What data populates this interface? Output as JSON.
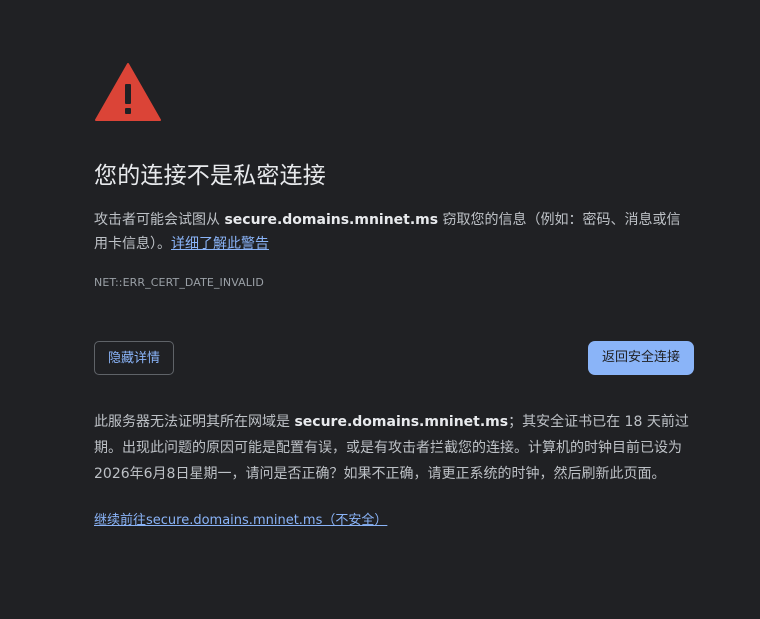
{
  "icon": {
    "name": "warning-triangle-icon",
    "color": "#db4437"
  },
  "heading": "您的连接不是私密连接",
  "description": {
    "before": "攻击者可能会试图从 ",
    "domain": "secure.domains.mninet.ms",
    "after": " 窃取您的信息（例如：密码、消息或信用卡信息）。",
    "learn_more_link": "详细了解此警告"
  },
  "error_code": "NET::ERR_CERT_DATE_INVALID",
  "buttons": {
    "hide_details": "隐藏详情",
    "back_to_safety": "返回安全连接"
  },
  "details": {
    "before": "此服务器无法证明其所在网域是 ",
    "domain": "secure.domains.mninet.ms",
    "after": "；其安全证书已在 18 天前过期。出现此问题的原因可能是配置有误，或是有攻击者拦截您的连接。计算机的时钟目前已设为 2026年6月8日星期一，请问是否正确？如果不正确，请更正系统的时钟，然后刷新此页面。"
  },
  "proceed_link": "继续前往secure.domains.mninet.ms（不安全）",
  "colors": {
    "background": "#202124",
    "accent": "#8ab4f8",
    "warning": "#db4437"
  }
}
